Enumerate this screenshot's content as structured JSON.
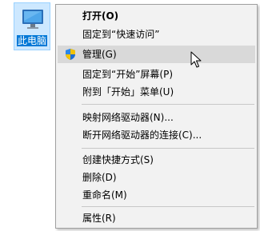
{
  "desktop": {
    "this_pc_label": "此电脑"
  },
  "menu": {
    "open": "打开(O)",
    "pin_quick_access": "固定到“快速访问”",
    "manage": "管理(G)",
    "pin_start": "固定到“开始”屏幕(P)",
    "pin_start_menu": "附到「开始」菜单(U)",
    "map_drive": "映射网络驱动器(N)...",
    "disconnect_drive": "断开网络驱动器的连接(C)...",
    "create_shortcut": "创建快捷方式(S)",
    "delete": "删除(D)",
    "rename": "重命名(M)",
    "properties": "属性(R)"
  },
  "icons": {
    "desktop_icon": "computer-icon",
    "shield": "uac-shield-icon",
    "cursor": "mouse-cursor-icon"
  },
  "colors": {
    "selection": "#cde8ff",
    "label_highlight": "#0078d7",
    "menu_bg": "#f2f2f2",
    "hover": "#d9d9d9"
  }
}
